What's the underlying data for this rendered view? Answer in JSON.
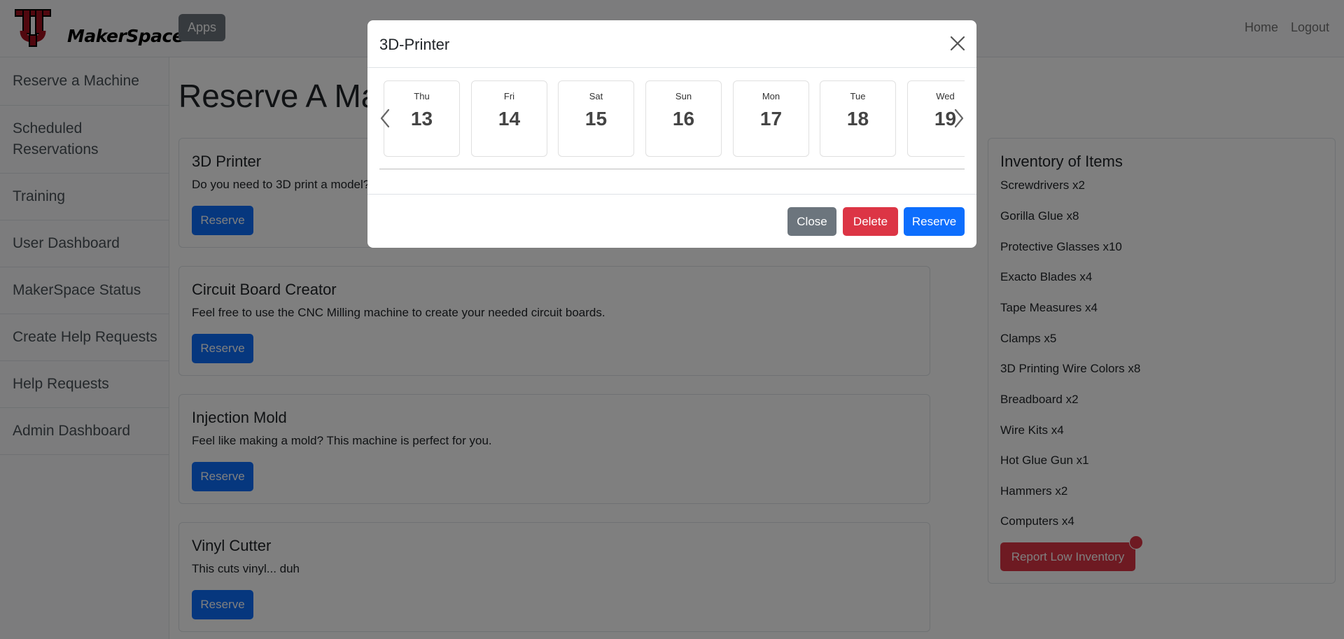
{
  "navbar": {
    "logo_text": "MakerSpace",
    "apps_label": "Apps",
    "links": [
      "Home",
      "Logout"
    ]
  },
  "sidebar": {
    "items": [
      {
        "label": "Reserve a Machine"
      },
      {
        "label": "Scheduled Reservations"
      },
      {
        "label": "Training"
      },
      {
        "label": "User Dashboard"
      },
      {
        "label": "MakerSpace Status"
      },
      {
        "label": "Create Help Requests"
      },
      {
        "label": "Help Requests"
      },
      {
        "label": "Admin Dashboard"
      }
    ]
  },
  "main": {
    "title": "Reserve A Machine",
    "machines": [
      {
        "title": "3D Printer",
        "description": "Do you need to 3D print a model?",
        "button": "Reserve"
      },
      {
        "title": "Circuit Board Creator",
        "description": "Feel free to use the CNC Milling machine to create your needed circuit boards.",
        "button": "Reserve"
      },
      {
        "title": "Injection Mold",
        "description": "Feel like making a mold? This machine is perfect for you.",
        "button": "Reserve"
      },
      {
        "title": "Vinyl Cutter",
        "description": "This cuts vinyl... duh",
        "button": "Reserve"
      }
    ]
  },
  "inventory": {
    "title": "Inventory of Items",
    "items": [
      "Screwdrivers x2",
      "Gorilla Glue x8",
      "Protective Glasses x10",
      "Exacto Blades x4",
      "Tape Measures x4",
      "Clamps x5",
      "3D Printing Wire Colors x8",
      "Breadboard x2",
      "Wire Kits x4",
      "Hot Glue Gun x1",
      "Hammers x2",
      "Computers x4"
    ],
    "report_button": "Report Low Inventory"
  },
  "modal": {
    "title": "3D-Printer",
    "days": [
      {
        "name": "Thu",
        "num": "13"
      },
      {
        "name": "Fri",
        "num": "14"
      },
      {
        "name": "Sat",
        "num": "15"
      },
      {
        "name": "Sun",
        "num": "16"
      },
      {
        "name": "Mon",
        "num": "17"
      },
      {
        "name": "Tue",
        "num": "18"
      },
      {
        "name": "Wed",
        "num": "19"
      }
    ],
    "buttons": {
      "close": "Close",
      "delete": "Delete",
      "reserve": "Reserve"
    }
  },
  "colors": {
    "primary": "#0d6efd",
    "danger": "#dc3545",
    "secondary": "#6c757d",
    "logo_red": "#a3101e"
  },
  "icons": {
    "close": "close-icon",
    "prev": "chevron-left-icon",
    "next": "chevron-right-icon",
    "logo": "ut-logo-icon"
  }
}
